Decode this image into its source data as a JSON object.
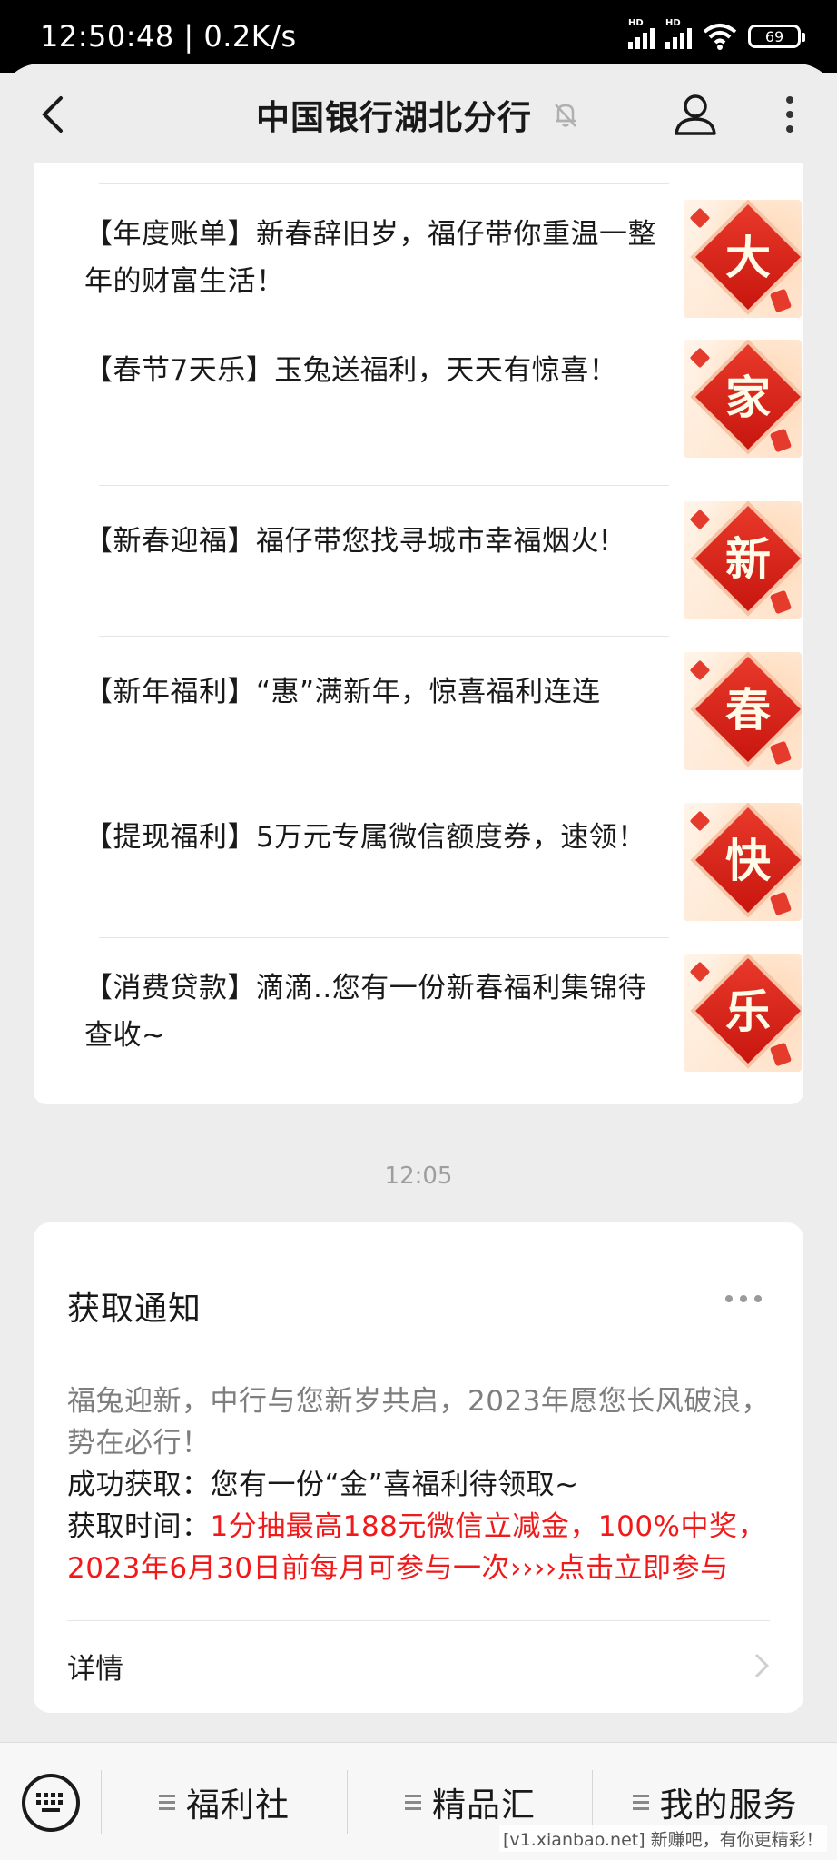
{
  "status_bar": {
    "time_speed": "12:50:48 | 0.2K/s",
    "network_badge": "HD",
    "battery": "69"
  },
  "header": {
    "title": "中国银行湖北分行",
    "icons": [
      "back-icon",
      "mute-bell-icon",
      "profile-icon",
      "more-icon"
    ]
  },
  "articles": [
    {
      "title": "【年度账单】新春辞旧岁，福仔带你重温一整年的财富生活！",
      "thumb_char": "大"
    },
    {
      "title": "【春节7天乐】玉兔送福利，天天有惊喜！",
      "thumb_char": "家"
    },
    {
      "title": "【新春迎福】福仔带您找寻城市幸福烟火!",
      "thumb_char": "新"
    },
    {
      "title": "【新年福利】“惠”满新年，惊喜福利连连",
      "thumb_char": "春"
    },
    {
      "title": "【提现福利】5万元专属微信额度券，速领！",
      "thumb_char": "快"
    },
    {
      "title": "【消费贷款】滴滴..您有一份新春福利集锦待查收~",
      "thumb_char": "乐"
    }
  ],
  "timestamp": "12:05",
  "notification": {
    "title": "获取通知",
    "intro": "福兔迎新，中行与您新岁共启，2023年愿您长风破浪，势在必行！",
    "success_label": "成功获取：",
    "success_value": "您有一份“金”喜福利待领取~",
    "time_label": "获取时间：",
    "time_value": "1分抽最高188元微信立减金，100%中奖，2023年6月30日前每月可参与一次››››点击立即参与",
    "detail_label": "详情"
  },
  "bottom_menu": {
    "items": [
      "福利社",
      "精品汇",
      "我的服务"
    ]
  },
  "watermark": "[v1.xianbao.net] 新赚吧，有你更精彩！"
}
